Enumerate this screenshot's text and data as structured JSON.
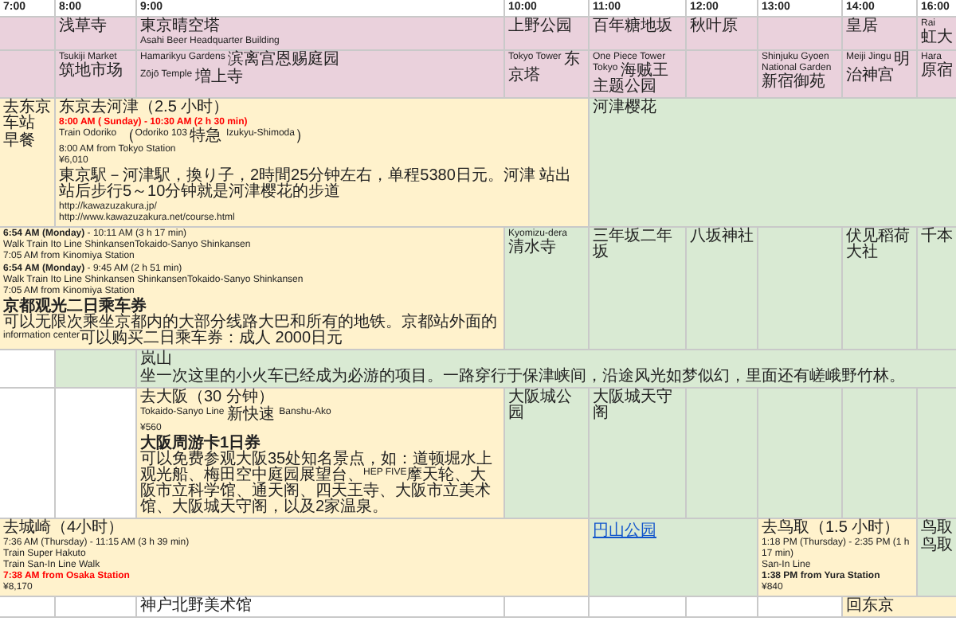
{
  "schedule": {
    "columns": [
      "7:00",
      "8:00",
      "9:00",
      "10:00",
      "11:00",
      "12:00",
      "13:00",
      "14:00",
      "16:00"
    ],
    "rows": [
      {
        "cells": [
          {
            "color": "#ead1dc"
          },
          {
            "color": "#ead1dc",
            "blocks": [
              [
                {
                  "kind": "text",
                  "text": "浅草寺"
                }
              ]
            ]
          },
          {
            "color": "#ead1dc",
            "blocks": [
              [
                {
                  "kind": "text",
                  "text": "東京晴空塔"
                }
              ],
              [
                {
                  "kind": "text",
                  "text": "Asahi Beer Headquarter Building"
                }
              ]
            ]
          },
          {
            "color": "#ead1dc",
            "blocks": [
              [
                {
                  "kind": "text",
                  "text": "上野公园"
                }
              ]
            ]
          },
          {
            "color": "#ead1dc",
            "blocks": [
              [
                {
                  "kind": "text",
                  "text": "百年糖地坂"
                }
              ]
            ]
          },
          {
            "color": "#ead1dc",
            "blocks": [
              [
                {
                  "kind": "text",
                  "text": "秋叶原"
                }
              ]
            ]
          },
          {
            "color": "#ead1dc"
          },
          {
            "color": "#ead1dc",
            "blocks": [
              [
                {
                  "kind": "text",
                  "text": "皇居"
                }
              ]
            ]
          },
          {
            "color": "#ead1dc",
            "blocks": [
              [
                {
                  "kind": "text",
                  "text": "Rai 虹大"
                }
              ]
            ]
          }
        ]
      },
      {
        "cells": [
          {
            "color": "#ead1dc"
          },
          {
            "color": "#ead1dc",
            "blocks": [
              [
                {
                  "kind": "text",
                  "text": "Tsukiji Market 筑地市场"
                }
              ]
            ]
          },
          {
            "color": "#ead1dc",
            "blocks": [
              [
                {
                  "kind": "text",
                  "text": "Hamarikyu Gardens 滨离宫恩赐庭园"
                }
              ],
              [
                {
                  "kind": "text",
                  "text": "Zōjō Temple 増上寺"
                }
              ]
            ]
          },
          {
            "color": "#ead1dc",
            "blocks": [
              [
                {
                  "kind": "text",
                  "text": "Tokyo Tower 东京塔"
                }
              ]
            ]
          },
          {
            "color": "#ead1dc",
            "blocks": [
              [
                {
                  "kind": "text",
                  "text": "One Piece Tower Tokyo 海贼王主题公园"
                }
              ]
            ]
          },
          {
            "color": "#ead1dc"
          },
          {
            "color": "#ead1dc",
            "blocks": [
              [
                {
                  "kind": "text",
                  "text": "Shinjuku Gyoen National Garden 新宿御苑"
                }
              ]
            ]
          },
          {
            "color": "#ead1dc",
            "blocks": [
              [
                {
                  "kind": "text",
                  "text": "Meiji Jingu 明治神宫"
                }
              ]
            ]
          },
          {
            "color": "#ead1dc",
            "blocks": [
              [
                {
                  "kind": "text",
                  "text": "Hara 原宿"
                }
              ]
            ]
          }
        ]
      },
      {
        "cells": [
          {
            "color": "#fff2cc",
            "blocks": [
              [
                {
                  "kind": "text",
                  "text": "去东京车站"
                }
              ],
              [
                {
                  "kind": "text",
                  "text": "早餐"
                }
              ]
            ]
          },
          {
            "color": "#fff2cc",
            "blocks": [
              [
                {
                  "kind": "text",
                  "text": "东京去河津（2.5 小时）"
                }
              ],
              [
                {
                  "kind": "red",
                  "text": "8:00 AM ( Sunday) - 10:30 AM (2 h 30 min)"
                },
                {
                  "kind": "text",
                  "text": "Train Odoriko （Odoriko 103 特急 Izukyu-Shimoda）"
                },
                {
                  "kind": "text",
                  "text": "8:00 AM from Tokyo Station"
                },
                {
                  "kind": "text",
                  "text": "¥6,010"
                }
              ],
              [
                {
                  "kind": "text",
                  "text": "東京駅－河津駅，換り子，2時間25分钟左右，单程5380日元。河津 站出站后步行5～10分钟就是河津樱花的步道"
                }
              ],
              [
                {
                  "kind": "text",
                  "text": "http://kawazuzakura.jp/"
                },
                {
                  "kind": "text",
                  "text": "http://www.kawazuzakura.net/course.html"
                }
              ]
            ]
          },
          "",
          "",
          {
            "color": "#d9ead3",
            "blocks": [
              [
                {
                  "kind": "text",
                  "text": "河津樱花"
                }
              ]
            ]
          },
          "",
          "",
          "",
          ""
        ]
      },
      {
        "cells": [
          {
            "color": "#fff2cc",
            "blocks": [
              [
                {
                  "kind": "text",
                  "text": "**6:54 AM (Monday)** - 10:11 AM (3 h 17 min)"
                },
                {
                  "kind": "text",
                  "text": "Walk Train Ito Line ShinkansenTokaido-Sanyo Shinkansen"
                },
                {
                  "kind": "text",
                  "text": "7:05 AM from Kinomiya Station"
                }
              ],
              [
                {
                  "kind": "text",
                  "text": "**6:54 AM (Monday)** - 9:45 AM (2 h 51 min)"
                },
                {
                  "kind": "text",
                  "text": "Walk Train Ito Line Shinkansen ShinkansenTokaido-Sanyo Shinkansen"
                },
                {
                  "kind": "text",
                  "text": "7:05 AM from Kinomiya Station"
                }
              ],
              [
                {
                  "kind": "bold",
                  "text": "京都观光二日乘车券"
                },
                {
                  "kind": "text",
                  "text": "可以无限次乘坐京都内的大部分线路大巴和所有的地铁。京都站外面的information center可以购买二日乘车券：成人 2000日元"
                }
              ]
            ]
          },
          "",
          "",
          {
            "color": "#d9ead3",
            "blocks": [
              [
                {
                  "kind": "text",
                  "text": "Kyomizu-dera 清水寺"
                }
              ]
            ]
          },
          {
            "color": "#d9ead3",
            "blocks": [
              [
                {
                  "kind": "text",
                  "text": "三年坂二年坂"
                }
              ]
            ]
          },
          {
            "color": "#d9ead3",
            "blocks": [
              [
                {
                  "kind": "text",
                  "text": "八坂神社"
                }
              ]
            ]
          },
          {
            "color": "#d9ead3"
          },
          {
            "color": "#d9ead3",
            "blocks": [
              [
                {
                  "kind": "text",
                  "text": "伏见稻荷大社"
                }
              ]
            ]
          },
          {
            "color": "#d9ead3",
            "blocks": [
              [
                {
                  "kind": "text",
                  "text": "千本"
                }
              ]
            ]
          }
        ]
      },
      {
        "cells": [
          {
            "color": "#ffffff"
          },
          {
            "color": "#d9ead3"
          },
          {
            "color": "#d9ead3",
            "blocks": [
              [
                {
                  "kind": "text",
                  "text": "岚山"
                }
              ],
              [
                {
                  "kind": "text",
                  "text": "坐一次这里的小火车已经成为必游的项目。一路穿行于保津峡间，沿途风光如梦似幻，里面还有嵯峨野竹林。"
                }
              ]
            ]
          },
          "",
          "",
          "",
          "",
          "",
          ""
        ]
      },
      {
        "cells": [
          {
            "color": "#ffffff"
          },
          {
            "color": "#ffffff"
          },
          {
            "color": "#fff2cc",
            "blocks": [
              [
                {
                  "kind": "text",
                  "text": "去大阪（30 分钟）"
                }
              ],
              [
                {
                  "kind": "text",
                  "text": "Tokaido-Sanyo Line 新快速 Banshu-Ako"
                },
                {
                  "kind": "text",
                  "text": "¥560"
                }
              ],
              [
                {
                  "kind": "bold",
                  "text": "大阪周游卡1日券"
                },
                {
                  "kind": "text",
                  "text": "可以免费参观大阪35处知名景点，如：道顿堀水上观光船、梅田空中庭园展望台、HEP FIVE摩天轮、大阪市立科学馆、通天阁、四天王寺、大阪市立美术馆、大阪城天守阁，以及2家温泉。"
                }
              ]
            ]
          },
          {
            "color": "#d9ead3",
            "blocks": [
              [
                {
                  "kind": "text",
                  "text": "大阪城公园"
                }
              ]
            ]
          },
          {
            "color": "#d9ead3",
            "blocks": [
              [
                {
                  "kind": "text",
                  "text": "大阪城天守阁"
                }
              ]
            ]
          },
          {
            "color": "#d9ead3"
          },
          {
            "color": "#d9ead3"
          },
          {
            "color": "#d9ead3"
          },
          {
            "color": "#d9ead3"
          }
        ]
      },
      {
        "cells": [
          {
            "color": "#fff2cc",
            "blocks": [
              [
                {
                  "kind": "text",
                  "text": "去城崎（4小时）"
                }
              ],
              [
                {
                  "kind": "text",
                  "text": "7:36 AM (Thursday) - 11:15 AM (3 h 39 min)"
                },
                {
                  "kind": "text",
                  "text": "Train Super Hakuto"
                },
                {
                  "kind": "text",
                  "text": "Train San-In Line Walk"
                },
                {
                  "kind": "red",
                  "text": "7:38 AM from Osaka Station"
                },
                {
                  "kind": "text",
                  "text": "¥8,170"
                }
              ]
            ]
          },
          "",
          "",
          "",
          {
            "color": "#d9ead3",
            "blocks": [
              [
                {
                  "kind": "link",
                  "text": "円山公园"
                }
              ]
            ]
          },
          "",
          {
            "color": "#fff2cc",
            "blocks": [
              [
                {
                  "kind": "text",
                  "text": "去鸟取（1.5 小时）"
                }
              ],
              [
                {
                  "kind": "text",
                  "text": "1:18 PM (Thursday) - 2:35 PM (1 h 17 min)"
                },
                {
                  "kind": "text",
                  "text": "San-In Line"
                },
                {
                  "kind": "bold",
                  "text": "1:38 PM from Yura Station"
                },
                {
                  "kind": "text",
                  "text": "¥840"
                }
              ]
            ]
          },
          "",
          {
            "color": "#d9ead3",
            "blocks": [
              [
                {
                  "kind": "text",
                  "text": "鸟取"
                }
              ],
              [
                {
                  "kind": "text",
                  "text": "鸟取"
                }
              ]
            ]
          }
        ]
      },
      {
        "cells": [
          {
            "color": "#ffffff"
          },
          {
            "color": "#ffffff"
          },
          {
            "color": "#ffffff",
            "blocks": [
              [
                {
                  "kind": "text",
                  "text": "神户北野美术馆"
                }
              ]
            ]
          },
          {
            "color": "#ffffff"
          },
          {
            "color": "#ffffff"
          },
          {
            "color": "#ffffff"
          },
          {
            "color": "#ffffff"
          },
          {
            "color": "#fff2cc",
            "blocks": [
              [
                {
                  "kind": "text",
                  "text": "回东京"
                }
              ]
            ]
          },
          ""
        ]
      }
    ]
  }
}
